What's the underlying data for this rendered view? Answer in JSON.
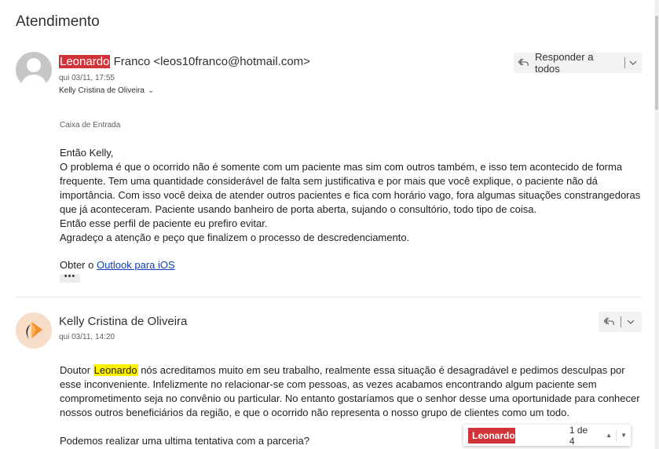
{
  "subject": "Atendimento",
  "find": {
    "query": "Leonardo",
    "count": "1 de 4"
  },
  "messages": [
    {
      "sender_highlight": "Leonardo",
      "sender_rest": " Franco <leos10franco@hotmail.com>",
      "date": "qui 03/11, 17:55",
      "to": "Kelly Cristina de Oliveira",
      "reply_all_label": "Responder a todos",
      "folder": "Caixa de Entrada",
      "body": [
        "Então Kelly,",
        "O problema é que o ocorrido não é somente com um paciente mas sim com outros também, e isso tem acontecido de forma frequente. Tem uma quantidade considerável de falta sem justificativa e por mais que você explique, o paciente não dá importância. Com isso você deixa de atender outros pacientes e fica com horário vago, fora algumas situações constrangedoras que já aconteceram. Paciente usando banheiro de porta aberta, sujando o consultório, todo tipo de coisa.",
        "Então esse perfil de paciente eu prefiro evitar.",
        "Agradeço a atenção e peço que finalizem o processo de descredenciamento."
      ],
      "signature_prefix": "Obter o ",
      "signature_link": "Outlook para iOS",
      "more_label": "•••"
    },
    {
      "sender": "Kelly Cristina de Oliveira",
      "date": "qui 03/11, 14:20",
      "body_prefix": "Doutor ",
      "body_highlight": "Leonardo",
      "body_rest": " nós acreditamos muito em seu trabalho, realmente essa situação é desagradável e pedimos desculpas por esse inconveniente. Infelizmente no relacionar-se com pessoas, as vezes acabamos encontrando algum paciente sem comprometimento seja no convênio ou particular. No entanto gostaríamos que o senhor desse uma oportunidade para conhecer nossos outros beneficiários da região, e que o ocorrido não representa o nosso grupo de clientes como um todo.",
      "body_2": "Podemos realizar uma ultima tentativa com a parceria?"
    }
  ],
  "icons": {
    "reply_all": "reply-all-icon",
    "dropdown": "chevron-down-icon",
    "expand_recipients": "double-chevron-down-icon",
    "find_prev": "chevron-up-icon",
    "find_next": "chevron-down-icon"
  },
  "colors": {
    "search_highlight": "#d13438",
    "keyword_highlight": "#fff100",
    "link": "#0f3fae",
    "avatar_bg": "#c8c6c4",
    "logo_bg": "#f7ddc8",
    "logo_orange": "#f28c28"
  }
}
